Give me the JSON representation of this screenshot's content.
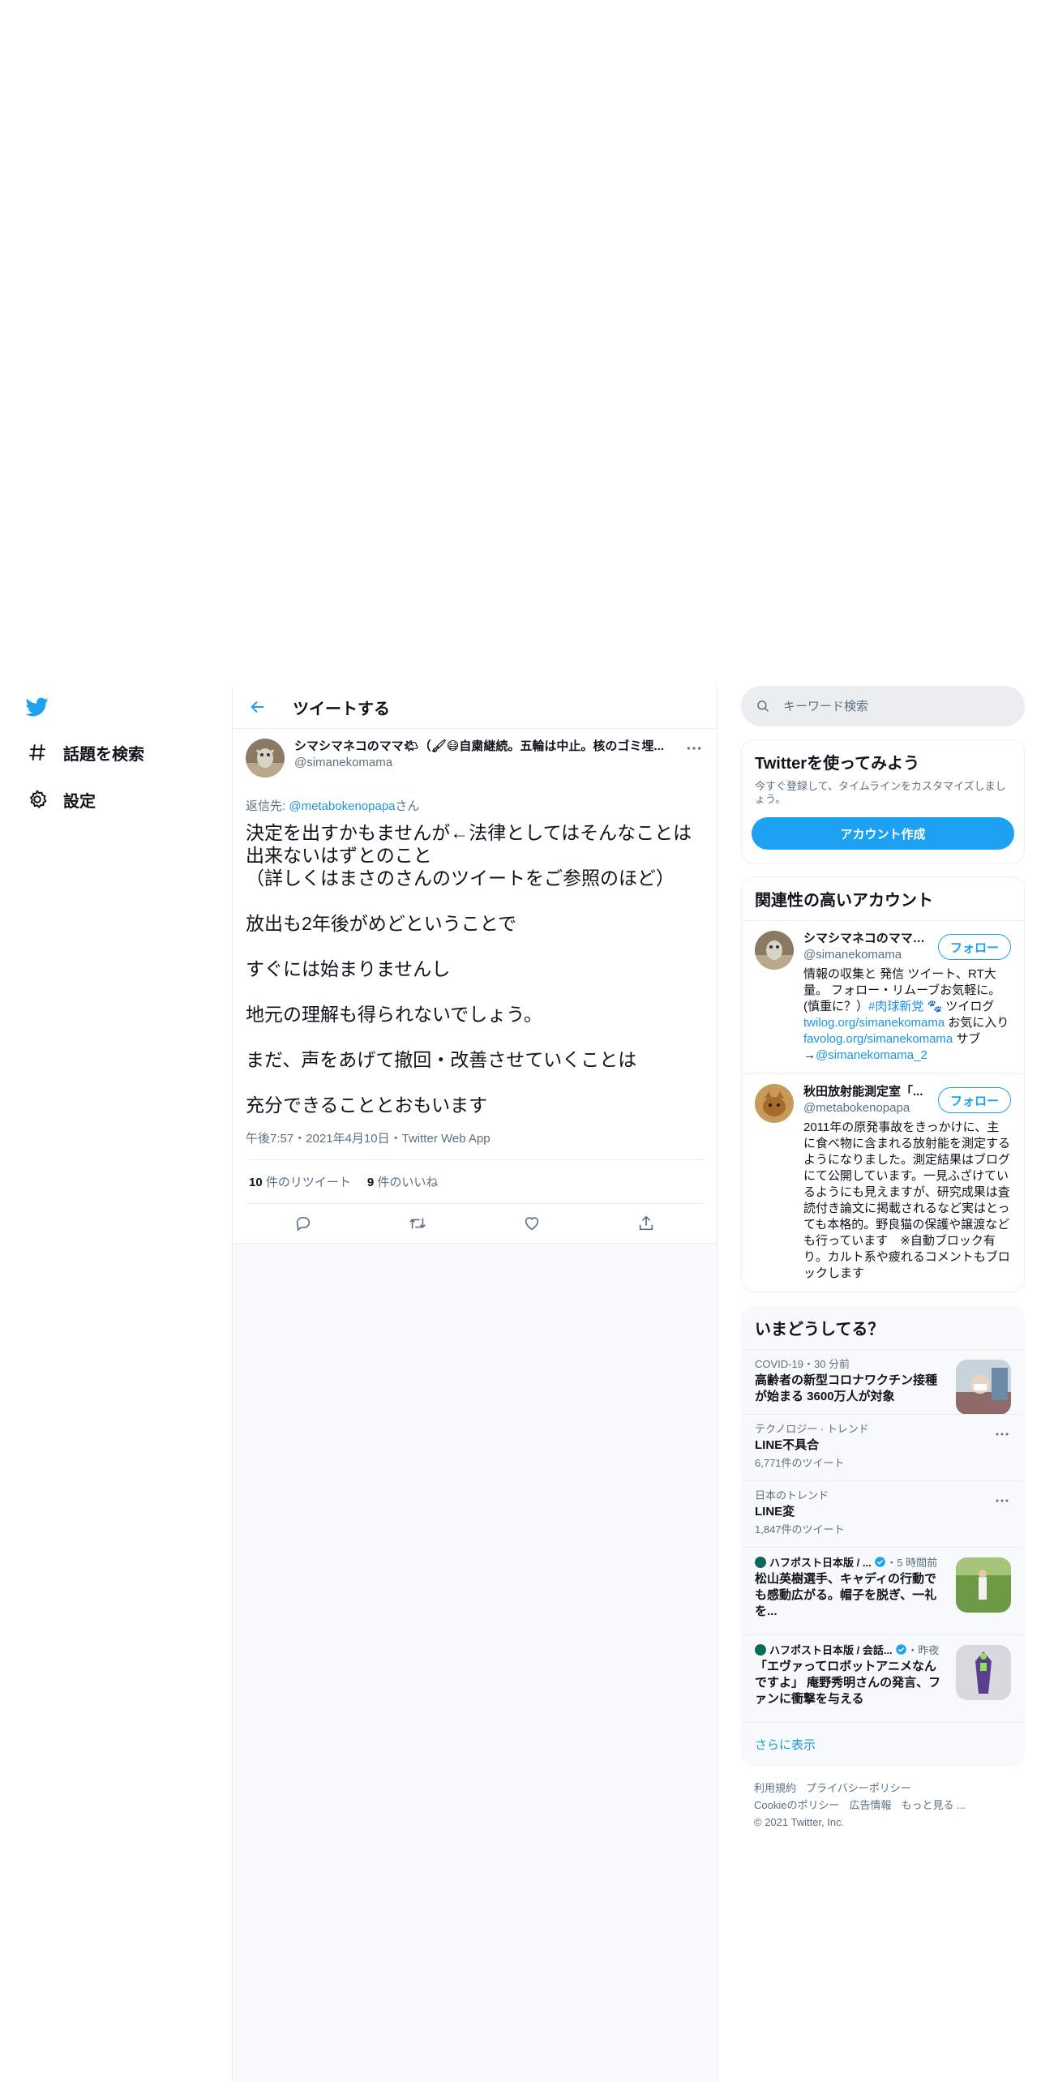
{
  "nav": {
    "explore_label": "話題を検索",
    "settings_label": "設定"
  },
  "header": {
    "title": "ツイートする"
  },
  "tweet": {
    "author_name": "シマシマネコのママ🌤（🖌😷自粛継続。五輪は中止。核のゴミ埋...",
    "author_handle": "@simanekomama",
    "reply_prefix": "返信先: ",
    "reply_to": "@metabokenopapa",
    "reply_suffix": "さん",
    "paragraphs": [
      "決定を出すかもませんが←法律としてはそんなことは出来ないはずとのこと\n（詳しくはまさのさんのツイートをご参照のほど）",
      "放出も2年後がめどということで",
      "すぐには始まりませんし",
      "地元の理解も得られないでしょう。",
      "まだ、声をあげて撤回・改善させていくことは",
      "充分できることとおもいます"
    ],
    "time": "午後7:57",
    "date": "2021年4月10日",
    "source": "Twitter Web App",
    "sep": "・",
    "retweet_count": "10",
    "retweet_label": " 件のリツイート",
    "like_count": "9",
    "like_label": " 件のいいね"
  },
  "search": {
    "placeholder": "キーワード検索"
  },
  "signup": {
    "title": "Twitterを使ってみよう",
    "desc": "今すぐ登録して、タイムラインをカスタマイズしましょう。",
    "button": "アカウント作成"
  },
  "relevant": {
    "title": "関連性の高いアカウント",
    "follow_label": "フォロー",
    "accounts": [
      {
        "name": "シマシマネコのママ🌤",
        "handle": "@simanekomama",
        "bio_1": "情報の収集と 発信 ツイート、RT大量。 フォロー・リムーブお気軽に。(慎重に？）",
        "bio_hashtag": "#肉球新党",
        "bio_2": " 🐾 ツイログ ",
        "bio_link_1": "twilog.org/simanekomama",
        "bio_3": " お気に入り ",
        "bio_link_2": "favolog.org/simanekomama",
        "bio_4": " サブ→",
        "bio_link_3": "@simanekomama_2"
      },
      {
        "name": "秋田放射能測定室「...",
        "handle": "@metabokenopapa",
        "bio": "2011年の原発事故をきっかけに、主に食べ物に含まれる放射能を測定するようになりました。測定結果はブログにて公開しています。一見ふざけているようにも見えますが、研究成果は査読付き論文に掲載されるなど実はとっても本格的。野良猫の保護や譲渡なども行っています　※自動ブロック有り。カルト系や疲れるコメントもブロックします"
      }
    ]
  },
  "trends": {
    "title": "いまどうしてる？",
    "items": [
      {
        "meta": "COVID-19・30 分前",
        "title": "高齢者の新型コロナワクチン接種が始まる 3600万人が対象"
      },
      {
        "meta": "テクノロジー · トレンド",
        "title": "LINE不具合",
        "count": "6,771件のツイート"
      },
      {
        "meta": "日本のトレンド",
        "title": "LINE変",
        "count": "1,847件のツイート"
      },
      {
        "meta_source": "ハフポスト日本版 / ...",
        "meta_time": "・5 時間前",
        "title": "松山英樹選手、キャディの行動でも感動広がる。帽子を脱ぎ、一礼を..."
      },
      {
        "meta_source": "ハフポスト日本版 / 会話...",
        "meta_time": "・昨夜",
        "title": "「エヴァってロボットアニメなんですよ」 庵野秀明さんの発言、ファンに衝撃を与える"
      }
    ],
    "show_more": "さらに表示"
  },
  "footer": {
    "terms": "利用規約",
    "privacy": "プライバシーポリシー",
    "cookie": "Cookieのポリシー",
    "ads": "広告情報",
    "more": "もっと見る ...",
    "copyright": "© 2021 Twitter, Inc."
  },
  "colors": {
    "accent": "#1da1f2",
    "link": "#1b95e0",
    "muted": "#5b7083",
    "border": "#ebeef0"
  }
}
